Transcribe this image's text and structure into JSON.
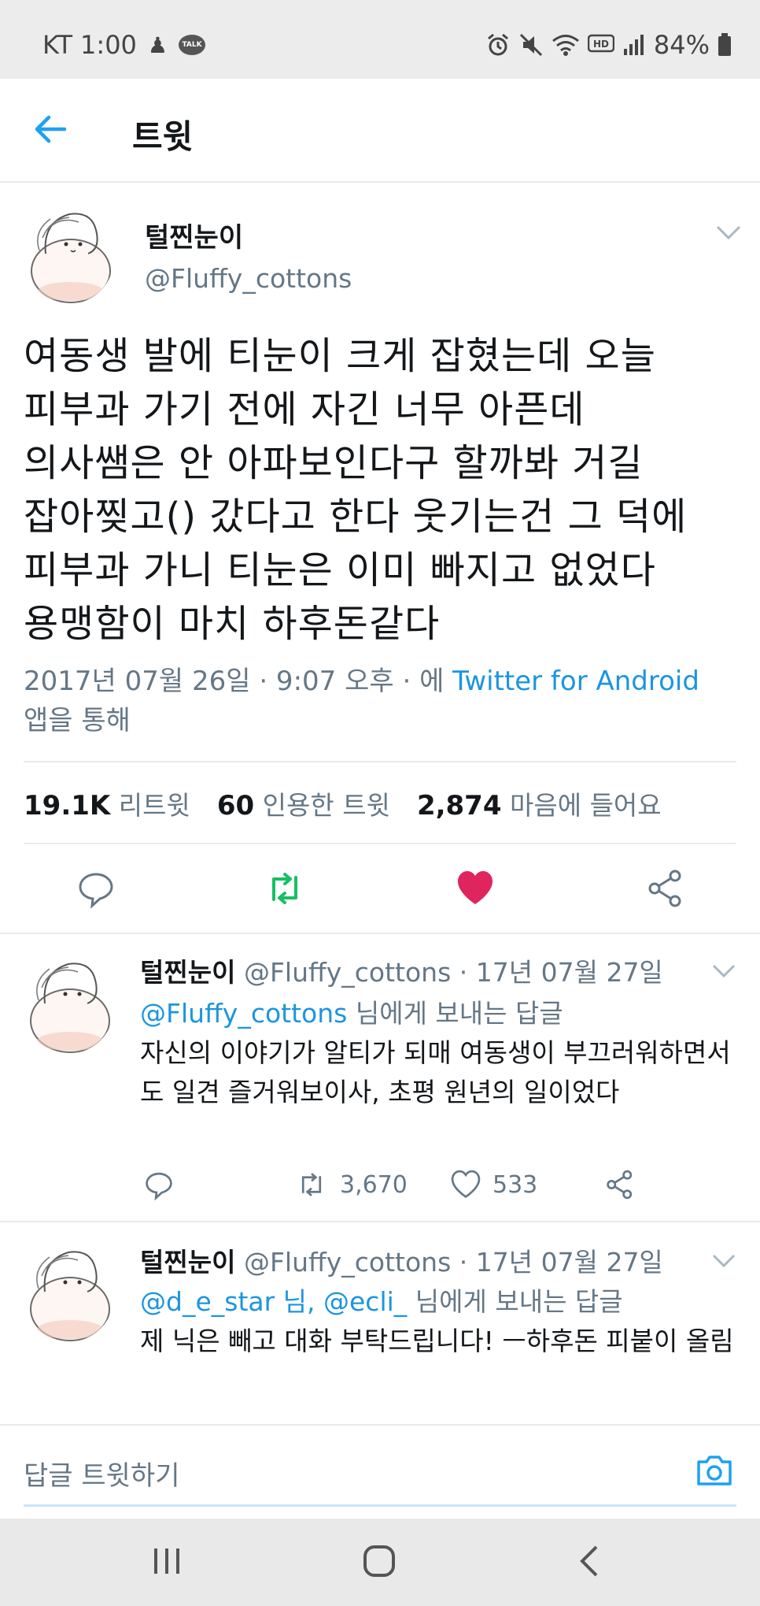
{
  "status_bar": {
    "carrier": "KT",
    "time": "1:00",
    "talk_badge": "TALK",
    "battery": "84%"
  },
  "header": {
    "title": "트윗"
  },
  "main_tweet": {
    "display_name": "털찐눈이",
    "handle": "@Fluffy_cottons",
    "text": "여동생 발에 티눈이 크게 잡혔는데 오늘\n피부과 가기 전에 자긴 너무 아픈데\n의사쌤은 안 아파보인다구 할까봐 거길\n잡아찢고() 갔다고 한다 웃기는건 그 덕에\n피부과 가니 티눈은 이미 빠지고 없었다\n용맹함이 마치 하후돈같다",
    "meta_prefix": "2017년 07월 26일 · 9:07 오후 · 에",
    "meta_source": "Twitter for Android",
    "meta_suffix": "앱을 통해",
    "stats": {
      "retweets_count": "19.1K",
      "retweets_label": "리트윗",
      "quotes_count": "60",
      "quotes_label": "인용한 트윗",
      "likes_count": "2,874",
      "likes_label": "마음에 들어요"
    }
  },
  "replies": [
    {
      "display_name": "털찐눈이",
      "handle_date": "@Fluffy_cottons · 17년 07월 27일",
      "reply_to_link": "@Fluffy_cottons",
      "reply_to_suffix": "님에게 보내는 답글",
      "text": "자신의 이야기가 알티가 되매 여동생이 부끄러워하면서도 일견 즐거워보이사, 초평 원년의 일이었다",
      "retweets": "3,670",
      "likes": "533"
    },
    {
      "display_name": "털찐눈이",
      "handle_date": "@Fluffy_cottons · 17년 07월 27일",
      "reply_to_link": "@d_e_star 님, @ecli_",
      "reply_to_suffix": "님에게 보내는 답글",
      "text": "제 닉은 빼고 대화 부탁드립니다! ㅡ하후돈 피붙이 올림"
    }
  ],
  "composer": {
    "placeholder": "답글 트윗하기"
  },
  "colors": {
    "accent": "#1da1f2",
    "retweet_active": "#17bf63",
    "like_active": "#e0245e",
    "secondary_text": "#657786"
  }
}
